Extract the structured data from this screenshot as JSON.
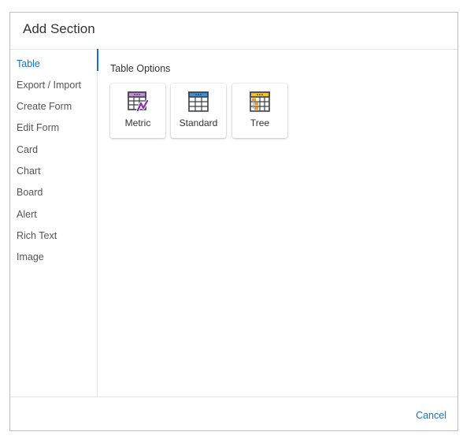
{
  "dialog": {
    "title": "Add Section",
    "cancel_label": "Cancel"
  },
  "sidebar": {
    "items": [
      {
        "label": "Table",
        "active": true
      },
      {
        "label": "Export / Import",
        "active": false
      },
      {
        "label": "Create Form",
        "active": false
      },
      {
        "label": "Edit Form",
        "active": false
      },
      {
        "label": "Card",
        "active": false
      },
      {
        "label": "Chart",
        "active": false
      },
      {
        "label": "Board",
        "active": false
      },
      {
        "label": "Alert",
        "active": false
      },
      {
        "label": "Rich Text",
        "active": false
      },
      {
        "label": "Image",
        "active": false
      }
    ]
  },
  "main": {
    "heading": "Table Options",
    "options": [
      {
        "label": "Metric",
        "icon": "metric-table-icon",
        "accent": "#c58bd6"
      },
      {
        "label": "Standard",
        "icon": "standard-table-icon",
        "accent": "#3b8fd9"
      },
      {
        "label": "Tree",
        "icon": "tree-table-icon",
        "accent": "#f2c230"
      }
    ]
  },
  "colors": {
    "accent": "#1a73b5",
    "border": "#bdbdbd",
    "divider": "#e3e3e3",
    "metric_line": "#8e2bb0",
    "tree_orange": "#f29a1f",
    "icon_dark": "#3a3f47"
  }
}
